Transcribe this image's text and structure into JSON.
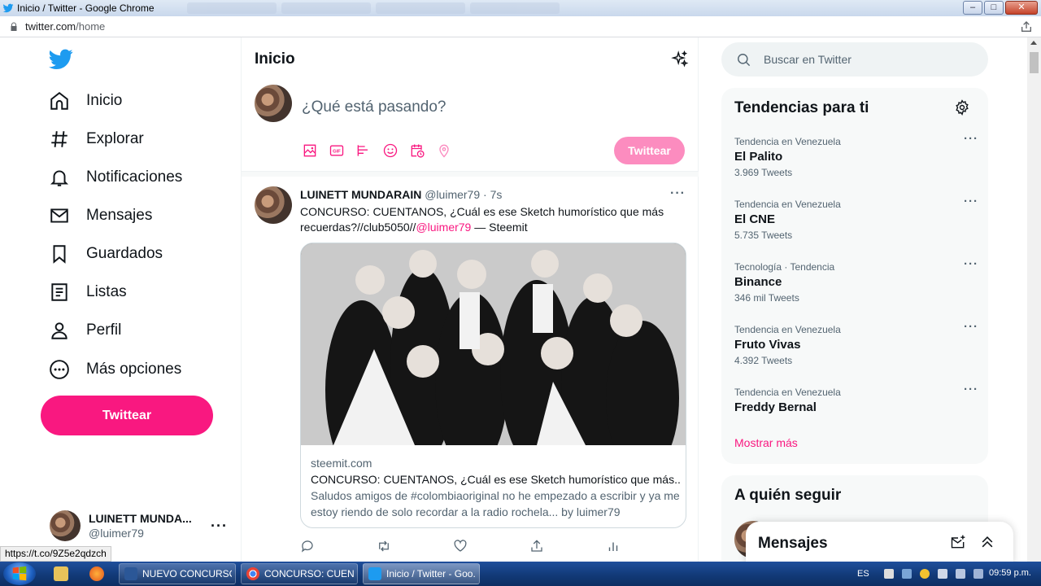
{
  "browser": {
    "window_title": "Inicio / Twitter - Google Chrome",
    "url_host": "twitter.com",
    "url_path": "/home",
    "window_buttons": {
      "minimize": "–",
      "maximize": "□",
      "close": "✕"
    }
  },
  "nav": {
    "items": [
      {
        "label": "Inicio",
        "icon": "home-icon"
      },
      {
        "label": "Explorar",
        "icon": "hashtag-icon"
      },
      {
        "label": "Notificaciones",
        "icon": "bell-icon"
      },
      {
        "label": "Mensajes",
        "icon": "mail-icon"
      },
      {
        "label": "Guardados",
        "icon": "bookmark-icon"
      },
      {
        "label": "Listas",
        "icon": "list-icon"
      },
      {
        "label": "Perfil",
        "icon": "person-icon"
      },
      {
        "label": "Más opciones",
        "icon": "more-circle-icon"
      }
    ],
    "tweet_button": "Twittear",
    "profile": {
      "name": "LUINETT MUNDA...",
      "handle": "@luimer79",
      "more": "···"
    }
  },
  "main": {
    "title": "Inicio",
    "composer": {
      "placeholder": "¿Qué está pasando?",
      "submit": "Twittear"
    },
    "tweet": {
      "name": "LUINETT MUNDARAIN",
      "handle": "@luimer79",
      "time": "· 7s",
      "text_before": "CONCURSO: CUENTANOS, ¿Cuál es ese Sketch humorístico que más recuerdas?//club5050//",
      "mention": "@luimer79",
      "text_after": " — Steemit",
      "more": "···",
      "card": {
        "domain": "steemit.com",
        "title": "CONCURSO: CUENTANOS, ¿Cuál es ese Sketch humorístico que más...",
        "description": "Saludos amigos de #colombiaoriginal no he empezado a escribir y ya me estoy riendo de solo recordar a la radio rochela... by luimer79"
      }
    }
  },
  "right": {
    "search_placeholder": "Buscar en Twitter",
    "trends_title": "Tendencias para ti",
    "trends": [
      {
        "context": "Tendencia en Venezuela",
        "name": "El Palito",
        "count": "3.969 Tweets"
      },
      {
        "context": "Tendencia en Venezuela",
        "name": "El CNE",
        "count": "5.735 Tweets"
      },
      {
        "context": "Tecnología · Tendencia",
        "name": "Binance",
        "count": "346 mil Tweets"
      },
      {
        "context": "Tendencia en Venezuela",
        "name": "Fruto Vivas",
        "count": "4.392 Tweets"
      },
      {
        "context": "Tendencia en Venezuela",
        "name": "Freddy Bernal",
        "count": ""
      }
    ],
    "trend_more": "···",
    "show_more": "Mostrar más",
    "follow_title": "A quién seguir"
  },
  "dm_drawer": {
    "title": "Mensajes"
  },
  "status_link": "https://t.co/9Z5e2qdzch",
  "taskbar": {
    "tasks": [
      {
        "label": "NUEVO CONCURSO ..."
      },
      {
        "label": "CONCURSO: CUENT..."
      },
      {
        "label": "Inicio / Twitter - Goo..."
      }
    ],
    "language": "ES",
    "clock": "09:59 p.m."
  },
  "colors": {
    "accent": "#f91880",
    "accent_light": "#fc8cbf",
    "twitter_blue": "#1d9bf0",
    "text_secondary": "#536471"
  }
}
